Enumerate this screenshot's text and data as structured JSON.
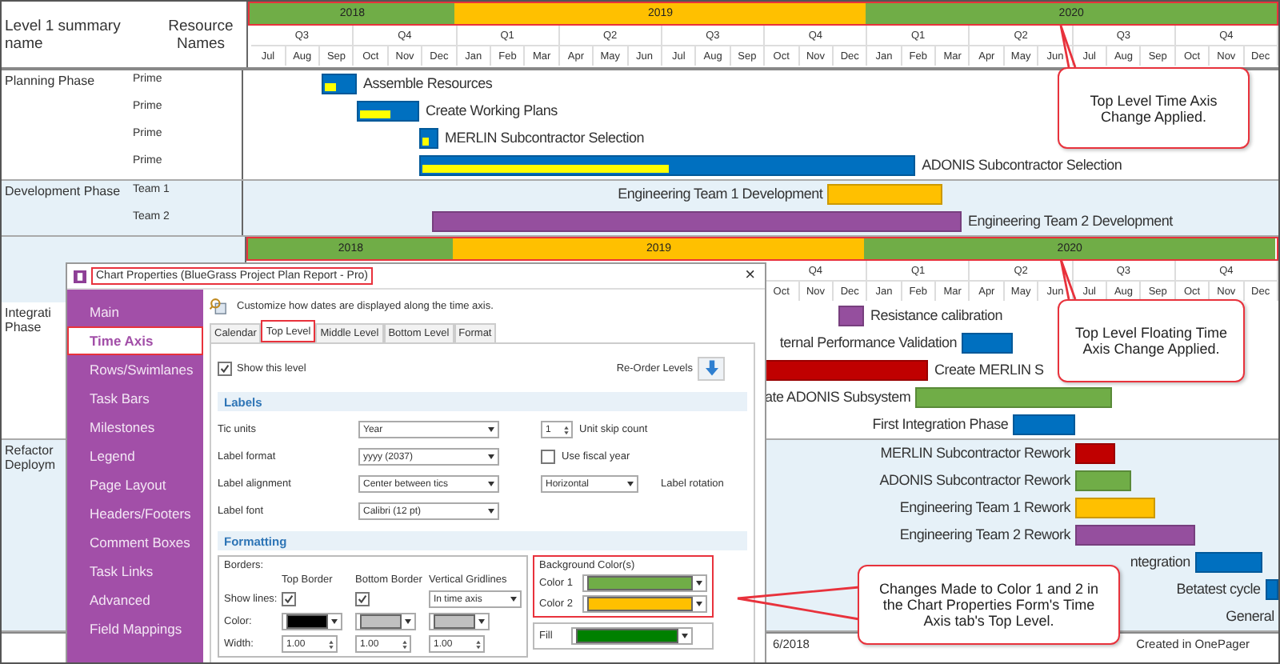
{
  "header": {
    "summary": "Level 1 summary name",
    "resource": "Resource Names"
  },
  "timeline": {
    "highlighted": true,
    "years": [
      {
        "label": "2018",
        "color": "#70ad47"
      },
      {
        "label": "2019",
        "color": "#ffc000"
      },
      {
        "label": "2020",
        "color": "#70ad47"
      }
    ],
    "quarters": [
      "Q3",
      "Q4",
      "Q1",
      "Q2",
      "Q3",
      "Q4",
      "Q1",
      "Q2",
      "Q3",
      "Q4"
    ],
    "months": [
      "Jul",
      "Aug",
      "Sep",
      "Oct",
      "Nov",
      "Dec",
      "Jan",
      "Feb",
      "Mar",
      "Apr",
      "May",
      "Jun",
      "Jul",
      "Aug",
      "Sep",
      "Oct",
      "Nov",
      "Dec",
      "Jan",
      "Feb",
      "Mar",
      "Apr",
      "May",
      "Jun",
      "Jul",
      "Aug",
      "Sep",
      "Oct",
      "Nov",
      "Dec"
    ]
  },
  "body": [
    {
      "kind": "section",
      "name": [
        "Planning Phase"
      ],
      "shaded": false,
      "rows": [
        {
          "resource": "Prime",
          "tasks": [
            {
              "label": "Assemble Resources",
              "color": "#0070c0",
              "level": 0.35,
              "kind": "trail"
            }
          ]
        },
        {
          "resource": "Prime",
          "tasks": [
            {
              "label": "Create Working Plans",
              "color": "#0070c0",
              "level": 0.5,
              "kind": "trail"
            }
          ]
        },
        {
          "resource": "Prime",
          "tasks": [
            {
              "label": "MERLIN Subcontractor Selection",
              "color": "#0070c0",
              "level": 0.4,
              "kind": "trail"
            }
          ]
        },
        {
          "resource": "Prime",
          "tasks": [
            {
              "label": "ADONIS Subcontractor Selection",
              "color": "#0070c0",
              "level": 0.5,
              "kind": "trail"
            }
          ]
        }
      ]
    },
    {
      "kind": "section",
      "name": [
        "Development Phase"
      ],
      "shaded": true,
      "rows": [
        {
          "resource": "Team 1",
          "tasks": [
            {
              "label": "Engineering Team 1 Development",
              "color": "#ffc000",
              "kind": "lead"
            }
          ]
        },
        {
          "resource": "Team 2",
          "tasks": [
            {
              "label": "Engineering Team 2 Development",
              "color": "#954f9e",
              "kind": "trail"
            }
          ]
        }
      ]
    },
    {
      "kind": "axis",
      "highlighted": true,
      "years": [
        {
          "label": "2018",
          "color": "#70ad47"
        },
        {
          "label": "2019",
          "color": "#ffc000"
        },
        {
          "label": "2020",
          "color": "#70ad47"
        }
      ],
      "quarters": [
        "Q4",
        "Q1",
        "Q2",
        "Q3",
        "Q4"
      ],
      "months": [
        "Oct",
        "Nov",
        "Dec",
        "Jan",
        "Feb",
        "Mar",
        "Apr",
        "May",
        "Jun",
        "Jul",
        "Aug",
        "Sep",
        "Oct",
        "Nov",
        "Dec"
      ]
    },
    {
      "kind": "section",
      "name": [
        "Integrati",
        "Phase"
      ],
      "shaded": false,
      "rows": [
        {
          "tasks": [
            {
              "label": "Resistance calibration",
              "color": "#954f9e",
              "kind": "trail"
            }
          ]
        },
        {
          "tasks": [
            {
              "label": "ternal Performance Validation",
              "color": "#0070c0",
              "kind": "lead"
            }
          ]
        },
        {
          "tasks": [
            {
              "label": "Create MERLIN S",
              "color": "#c00000",
              "kind": "trail"
            }
          ]
        },
        {
          "tasks": [
            {
              "label": "ate ADONIS Subsystem",
              "color": "#70ad47",
              "kind": "lead"
            }
          ]
        },
        {
          "tasks": [
            {
              "label": "First Integration Phase",
              "color": "#0070c0",
              "kind": "lead"
            }
          ]
        }
      ]
    },
    {
      "kind": "section",
      "name": [
        "Refactor",
        "Deploym"
      ],
      "shaded": true,
      "rows": [
        {
          "tasks": [
            {
              "label": "MERLIN Subcontractor Rework",
              "color": "#c00000",
              "kind": "lead"
            }
          ]
        },
        {
          "tasks": [
            {
              "label": "ADONIS Subcontractor Rework",
              "color": "#70ad47",
              "kind": "lead"
            }
          ]
        },
        {
          "tasks": [
            {
              "label": "Engineering Team 1 Rework",
              "color": "#ffc000",
              "kind": "lead"
            }
          ]
        },
        {
          "tasks": [
            {
              "label": "Engineering Team 2 Rework",
              "color": "#954f9e",
              "kind": "lead"
            }
          ]
        },
        {
          "tasks": [
            {
              "label": "ntegration",
              "color": "#0070c0",
              "kind": "lead"
            }
          ]
        },
        {
          "tasks": [
            {
              "label": "Betatest cycle",
              "color": "#0070c0",
              "kind": "lead"
            }
          ]
        },
        {
          "tasks": [
            {
              "label": "General",
              "kind": "lead"
            }
          ]
        }
      ]
    }
  ],
  "footer": {
    "date": "6/2018",
    "credit": "Created in OnePager"
  },
  "dialog": {
    "title": "Chart Properties (BlueGrass Project Plan Report - Pro)",
    "title_highlighted": true,
    "close": "×",
    "nav": [
      {
        "label": "Main",
        "selected": false,
        "highlighted": false
      },
      {
        "label": "Time Axis",
        "selected": true,
        "highlighted": true
      },
      {
        "label": "Rows/Swimlanes",
        "selected": false,
        "highlighted": false
      },
      {
        "label": "Task Bars",
        "selected": false,
        "highlighted": false
      },
      {
        "label": "Milestones",
        "selected": false,
        "highlighted": false
      },
      {
        "label": "Legend",
        "selected": false,
        "highlighted": false
      },
      {
        "label": "Page Layout",
        "selected": false,
        "highlighted": false
      },
      {
        "label": "Headers/Footers",
        "selected": false,
        "highlighted": false
      },
      {
        "label": "Comment Boxes",
        "selected": false,
        "highlighted": false
      },
      {
        "label": "Task Links",
        "selected": false,
        "highlighted": false
      },
      {
        "label": "Advanced",
        "selected": false,
        "highlighted": false
      },
      {
        "label": "Field Mappings",
        "selected": false,
        "highlighted": false
      }
    ],
    "description": "Customize how dates are displayed along the time axis.",
    "tabs": [
      {
        "label": "Calendar",
        "selected": false,
        "highlighted": false
      },
      {
        "label": "Top Level",
        "selected": true,
        "highlighted": true
      },
      {
        "label": "Middle Level",
        "selected": false,
        "highlighted": false
      },
      {
        "label": "Bottom Level",
        "selected": false,
        "highlighted": false
      },
      {
        "label": "Format",
        "selected": false,
        "highlighted": false
      }
    ],
    "show_level": {
      "label": "Show this level",
      "checked": true
    },
    "reorder": "Re-Order Levels",
    "labels_header": "Labels",
    "label_rows": [
      {
        "label": "Tic units",
        "value": "Year",
        "extra": {
          "kind": "spinner",
          "value": "1",
          "label": "Unit skip count"
        }
      },
      {
        "label": "Label format",
        "value": "yyyy (2037)",
        "extra": {
          "kind": "checkbox",
          "label": "Use fiscal year",
          "checked": false
        }
      },
      {
        "label": "Label alignment",
        "value": "Center between tics",
        "extra": {
          "kind": "select",
          "value": "Horizontal",
          "label": "Label rotation"
        }
      },
      {
        "label": "Label font",
        "value": "Calibri (12 pt)"
      }
    ],
    "formatting_header": "Formatting",
    "borders": {
      "title": "Borders:",
      "columns": [
        "Top Border",
        "Bottom Border",
        "Vertical Gridlines"
      ],
      "show_lines": {
        "label": "Show lines:",
        "top": true,
        "bottom": true,
        "gridlines": "In time axis"
      },
      "color": {
        "label": "Color:",
        "swatches": [
          {
            "color": "#000000"
          },
          {
            "color": "#c0c0c0"
          },
          {
            "color": "#c0c0c0"
          }
        ]
      },
      "width": {
        "label": "Width:",
        "values": [
          "1.00",
          "1.00",
          "1.00"
        ]
      }
    },
    "background": {
      "title": "Background Color(s)",
      "highlighted": true,
      "colors": [
        {
          "label": "Color 1",
          "color": "#70ad47"
        },
        {
          "label": "Color 2",
          "color": "#ffc000"
        }
      ]
    },
    "fill": {
      "label": "Fill",
      "color": "#008000"
    }
  },
  "callouts": [
    {
      "text": "Top Level Time Axis Change Applied."
    },
    {
      "text": "Top Level Floating Time Axis Change Applied."
    },
    {
      "text": "Changes Made to Color 1 and  2 in the Chart Properties Form's Time Axis tab's Top Level."
    }
  ]
}
